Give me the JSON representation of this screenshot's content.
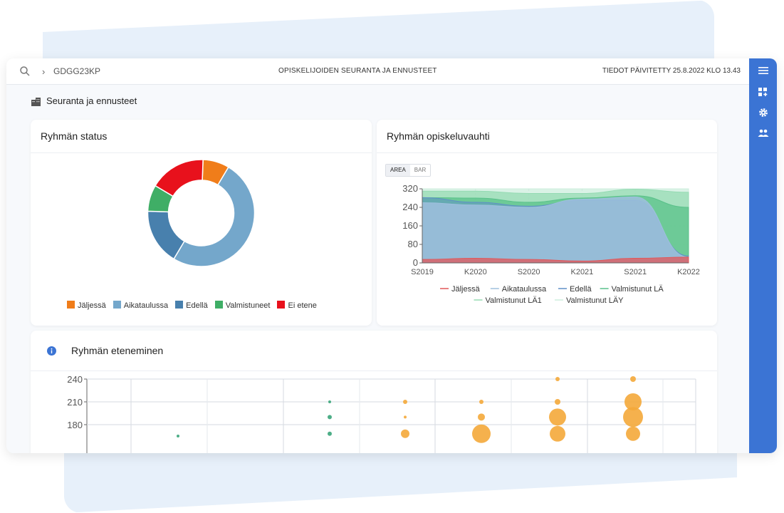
{
  "topbar": {
    "breadcrumb": "GDGG23KP",
    "title": "OPISKELIJOIDEN SEURANTA JA ENNUSTEET",
    "updated": "TIEDOT PÄIVITETTY 25.8.2022 KLO 13.43"
  },
  "page": {
    "section_title": "Seuranta ja ennusteet"
  },
  "status_card": {
    "title": "Ryhmän status",
    "legend": [
      {
        "label": "Jäljessä",
        "color": "#f07d1a"
      },
      {
        "label": "Aikataulussa",
        "color": "#74a7cb"
      },
      {
        "label": "Edellä",
        "color": "#4880ad"
      },
      {
        "label": "Valmistuneet",
        "color": "#3fae66"
      },
      {
        "label": "Ei etene",
        "color": "#e8111c"
      }
    ]
  },
  "pace_card": {
    "title": "Ryhmän opiskeluvauhti",
    "toggle": {
      "area": "AREA",
      "bar": "BAR"
    },
    "legend_row1": [
      "Jäljessä",
      "Aikataulussa",
      "Edellä",
      "Valmistunut LÄ"
    ],
    "legend_row2": [
      "Valmistunut LÄ1",
      "Valmistunut LÄY"
    ]
  },
  "progress_card": {
    "title": "Ryhmän eteneminen"
  },
  "chart_data": [
    {
      "type": "pie",
      "title": "Ryhmän status",
      "categories": [
        "Jäljessä",
        "Aikataulussa",
        "Edellä",
        "Valmistuneet",
        "Ei etene"
      ],
      "values": [
        8,
        50,
        17,
        8,
        17
      ],
      "colors": [
        "#f07d1a",
        "#74a7cb",
        "#4880ad",
        "#3fae66",
        "#e8111c"
      ],
      "legend": "bottom"
    },
    {
      "type": "area",
      "title": "Ryhmän opiskeluvauhti",
      "x": [
        "S2019",
        "K2020",
        "S2020",
        "K2021",
        "S2021",
        "K2022"
      ],
      "ylim": [
        0,
        320
      ],
      "yticks": [
        0,
        80,
        160,
        240,
        320
      ],
      "grid": true,
      "legend": "bottom",
      "series": [
        {
          "name": "Jäljessä",
          "color": "#e15759",
          "values": [
            15,
            20,
            15,
            8,
            20,
            25
          ]
        },
        {
          "name": "Aikataulussa",
          "color": "#9fc0de",
          "values": [
            260,
            250,
            240,
            275,
            285,
            25
          ]
        },
        {
          "name": "Edellä",
          "color": "#5f8fc7",
          "values": [
            282,
            262,
            245,
            270,
            270,
            30
          ]
        },
        {
          "name": "Valmistunut LÄ",
          "color": "#59c18a",
          "values": [
            282,
            280,
            262,
            280,
            290,
            240
          ]
        },
        {
          "name": "Valmistunut LÄ1",
          "color": "#95dbb3",
          "values": [
            310,
            310,
            300,
            300,
            318,
            305
          ]
        },
        {
          "name": "Valmistunut LÄY",
          "color": "#cdeedd",
          "values": [
            320,
            320,
            320,
            320,
            320,
            320
          ]
        }
      ]
    },
    {
      "type": "scatter",
      "title": "Ryhmän eteneminen",
      "yticks": [
        240,
        210,
        180
      ],
      "points": [
        {
          "x": 1,
          "y": 165,
          "size": 2,
          "color": "#3aa57a"
        },
        {
          "x": 2,
          "y": 210,
          "size": 2,
          "color": "#3aa57a"
        },
        {
          "x": 2,
          "y": 190,
          "size": 3,
          "color": "#3aa57a"
        },
        {
          "x": 2,
          "y": 168,
          "size": 3,
          "color": "#3aa57a"
        },
        {
          "x": 3,
          "y": 210,
          "size": 3,
          "color": "#f4a93a"
        },
        {
          "x": 3,
          "y": 190,
          "size": 2,
          "color": "#f4a93a"
        },
        {
          "x": 3,
          "y": 168,
          "size": 6,
          "color": "#f4a93a"
        },
        {
          "x": 4,
          "y": 210,
          "size": 3,
          "color": "#f4a93a"
        },
        {
          "x": 4,
          "y": 190,
          "size": 5,
          "color": "#f4a93a"
        },
        {
          "x": 4,
          "y": 168,
          "size": 13,
          "color": "#f4a93a"
        },
        {
          "x": 5,
          "y": 240,
          "size": 3,
          "color": "#f4a93a"
        },
        {
          "x": 5,
          "y": 210,
          "size": 4,
          "color": "#f4a93a"
        },
        {
          "x": 5,
          "y": 190,
          "size": 12,
          "color": "#f4a93a"
        },
        {
          "x": 5,
          "y": 168,
          "size": 11,
          "color": "#f4a93a"
        },
        {
          "x": 6,
          "y": 240,
          "size": 4,
          "color": "#f4a93a"
        },
        {
          "x": 6,
          "y": 210,
          "size": 12,
          "color": "#f4a93a"
        },
        {
          "x": 6,
          "y": 190,
          "size": 14,
          "color": "#f4a93a"
        },
        {
          "x": 6,
          "y": 168,
          "size": 10,
          "color": "#f4a93a"
        }
      ]
    }
  ]
}
